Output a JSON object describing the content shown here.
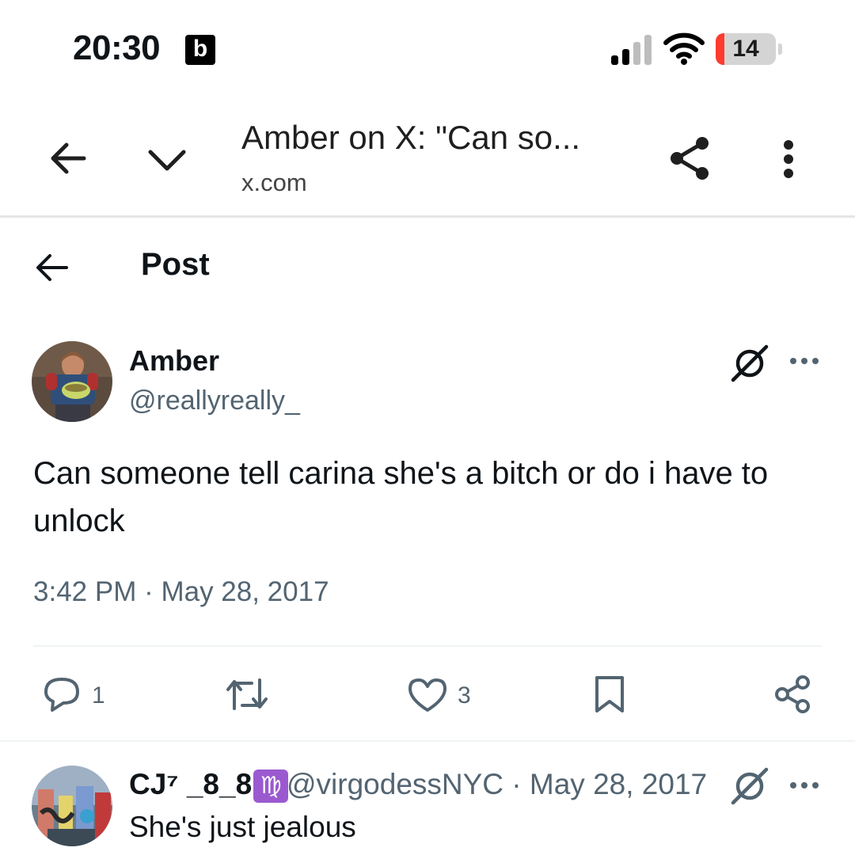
{
  "status_bar": {
    "time": "20:30",
    "notification_badge": "b",
    "battery_level": "14",
    "battery_fraction": 0.14
  },
  "browser": {
    "title": "Amber on X: \"Can so...",
    "url": "x.com"
  },
  "page": {
    "title": "Post"
  },
  "post": {
    "author_name": "Amber",
    "author_handle": "@reallyreally_",
    "text": "Can someone tell carina she's a bitch or do i have to unlock",
    "timestamp": "3:42 PM · May 28, 2017",
    "actions": {
      "reply_count": "1",
      "retweet_count": "",
      "like_count": "3"
    }
  },
  "reply": {
    "author_name": "CJ⁷ _8_8",
    "author_badge": "♍",
    "author_handle": "@virgodessNYC · May 28, 2017",
    "text": "She's just jealous"
  },
  "colors": {
    "secondary_text": "#536471",
    "primary_text": "#0f1419",
    "divider": "#eff3f4",
    "battery_low": "#ff3b30",
    "virgo_badge": "#9b59d0"
  },
  "icons": [
    "signal-icon",
    "wifi-icon",
    "back-arrow-icon",
    "chevron-down-icon",
    "share-icon",
    "more-vertical-icon",
    "grok-icon",
    "more-horizontal-icon",
    "reply-icon",
    "retweet-icon",
    "like-icon",
    "bookmark-icon",
    "share-node-icon"
  ]
}
